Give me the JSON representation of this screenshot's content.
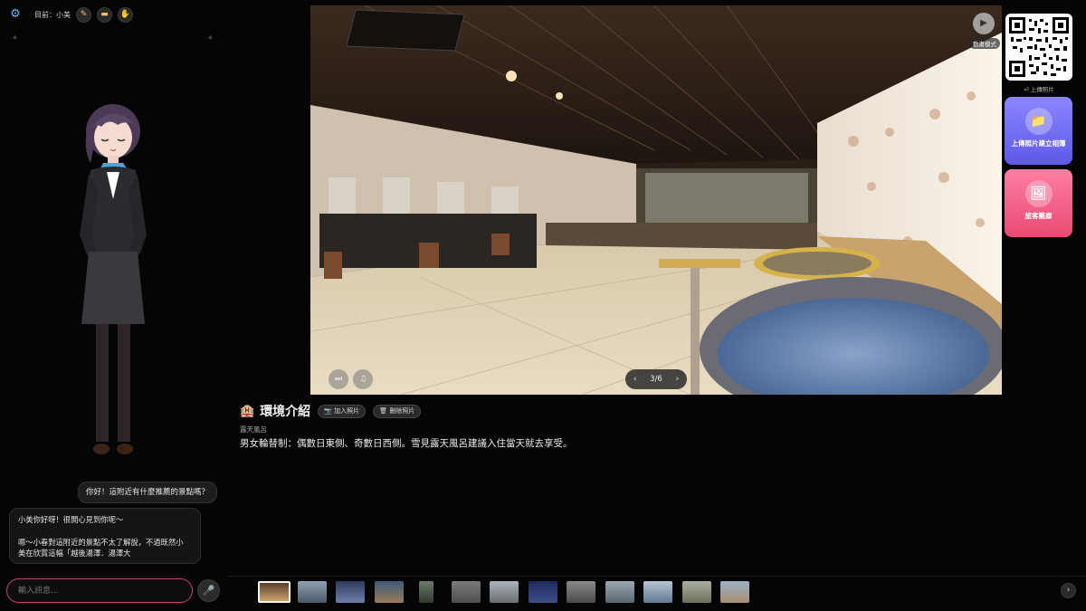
{
  "toolbar": {
    "current_label": "目前：小美",
    "buttons": [
      "pencil-icon",
      "folder-icon",
      "hand-icon"
    ]
  },
  "chat": {
    "user_message": "你好！這附近有什麼推薦的景點嗎？",
    "bot_line1": "小美你好呀！很開心見到你呢～",
    "bot_line2": "嗯～小春對這附近的景點不太了解說，不過既然小",
    "bot_line3": "美在欣賞這幅「越後湯澤．湯澤大",
    "input_placeholder": "輸入訊息..."
  },
  "viewer": {
    "page_indicator": "3/6",
    "mode_label": "動畫模式"
  },
  "right_panel": {
    "qr_label": "⏎ 上傳照片",
    "upload_card_label": "上傳照片建立相簿",
    "gallery_card_label": "旅客藝廊"
  },
  "info": {
    "title": "環境介紹",
    "add_photo": "加入照片",
    "delete_photo": "刪除照片",
    "subtitle": "露天風呂",
    "description": "男女輪替制：偶數日東側、奇數日西側。雪見露天風呂建議入住當天就去享受。"
  },
  "thumbnails": {
    "count": 13,
    "active_index": 0
  },
  "colors": {
    "accent_pink": "#c7466e",
    "upload_card": "#6b64f0",
    "gallery_card": "#f0567f"
  }
}
